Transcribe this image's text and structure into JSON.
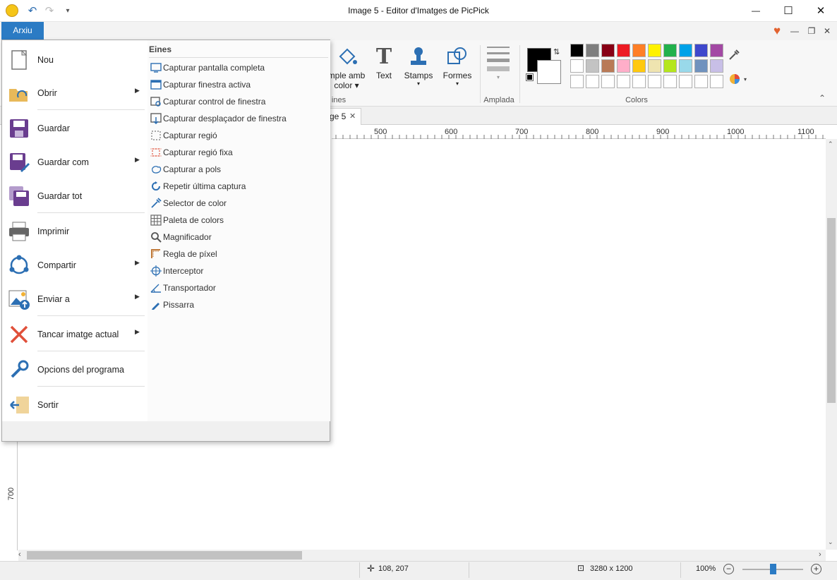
{
  "window": {
    "title": "Image 5 - Editor d'Imatges de PicPick",
    "minimize": "—",
    "maximize": "☐",
    "close": "✕"
  },
  "quick_access": {
    "undo": "↶",
    "redo": "↷",
    "customize": "▾"
  },
  "menu": {
    "file_tab": "Arxiu"
  },
  "ribbon": {
    "simple_color": "mple amb",
    "simple_color_2": "color",
    "text": "Text",
    "stamps": "Stamps",
    "formes": "Formes",
    "group_lines": "ines",
    "group_amplada": "Amplada",
    "group_colors": "Colors",
    "collapse": "⌃"
  },
  "palette": {
    "row1": [
      "#000000",
      "#7f7f7f",
      "#880015",
      "#ed1c24",
      "#ff7f27",
      "#fff200",
      "#22b14c",
      "#00a2e8",
      "#3f48cc",
      "#a349a4"
    ],
    "row2": [
      "#ffffff",
      "#c3c3c3",
      "#b97a57",
      "#ffaec9",
      "#ffc90e",
      "#efe4b0",
      "#b5e61d",
      "#99d9ea",
      "#7092be",
      "#c8bfe7"
    ],
    "row3": [
      "#ffffff",
      "#ffffff",
      "#ffffff",
      "#ffffff",
      "#ffffff",
      "#ffffff",
      "#ffffff",
      "#ffffff",
      "#ffffff",
      "#ffffff"
    ],
    "primary": "#000000",
    "secondary": "#ffffff"
  },
  "tab": {
    "label": "ge 5",
    "close": "✕"
  },
  "ruler": {
    "h_labels": [
      "500",
      "600",
      "700",
      "800",
      "900",
      "1000",
      "1100"
    ],
    "v_label": "700"
  },
  "status": {
    "coords": "108, 207",
    "size": "3280 x 1200",
    "zoom": "100%"
  },
  "file_menu": {
    "items": [
      {
        "label": "Nou",
        "arrow": false
      },
      {
        "label": "Obrir",
        "arrow": true
      },
      {
        "label": "Guardar",
        "arrow": false
      },
      {
        "label": "Guardar com",
        "arrow": true
      },
      {
        "label": "Guardar tot",
        "arrow": false
      },
      {
        "label": "Imprimir",
        "arrow": false
      },
      {
        "label": "Compartir",
        "arrow": true
      },
      {
        "label": "Enviar a",
        "arrow": true
      },
      {
        "label": "Tancar imatge actual",
        "arrow": true
      },
      {
        "label": "Opcions del programa",
        "arrow": false
      },
      {
        "label": "Sortir",
        "arrow": false
      }
    ],
    "tools_heading": "Eines",
    "tools": [
      "Capturar pantalla completa",
      "Capturar finestra activa",
      "Capturar control de finestra",
      "Capturar desplaçador de finestra",
      "Capturar regió",
      "Capturar regió fixa",
      "Capturar a pols",
      "Repetir última captura",
      "Selector de color",
      "Paleta de colors",
      "Magnificador",
      "Regla de píxel",
      "Interceptor",
      "Transportador",
      "Pissarra"
    ]
  }
}
